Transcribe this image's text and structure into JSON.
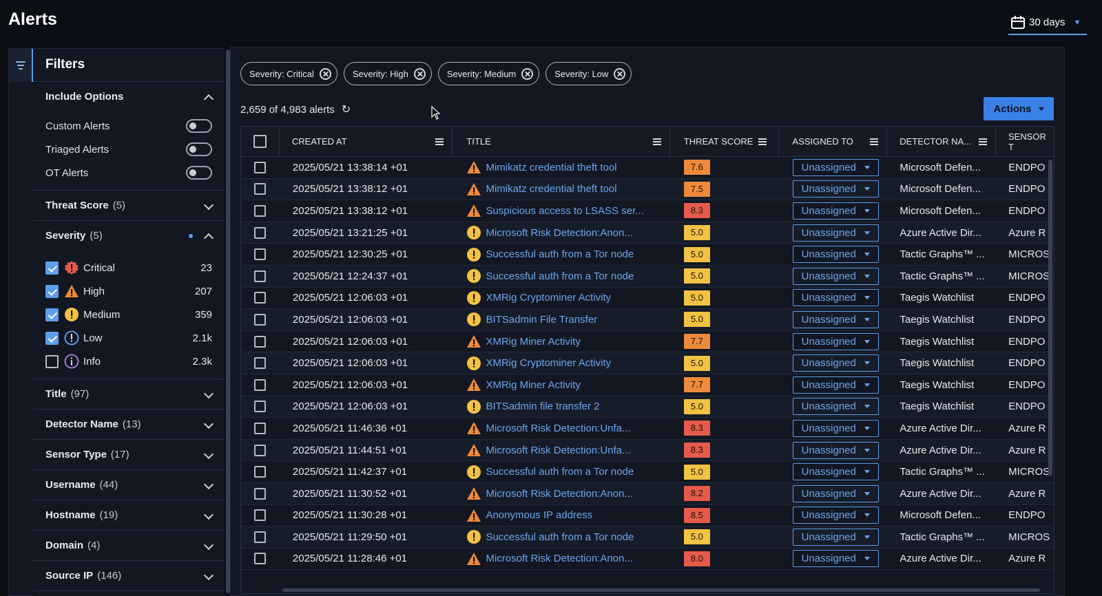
{
  "header": {
    "title": "Alerts",
    "date_range": "30 days"
  },
  "filters": {
    "title": "Filters",
    "include_options": {
      "label": "Include Options",
      "options": [
        {
          "label": "Custom Alerts",
          "on": false
        },
        {
          "label": "Triaged Alerts",
          "on": false
        },
        {
          "label": "OT Alerts",
          "on": false
        }
      ]
    },
    "threat_score": {
      "label": "Threat Score",
      "count": "(5)"
    },
    "severity": {
      "label": "Severity",
      "count": "(5)",
      "items": [
        {
          "label": "Critical",
          "count": "23",
          "checked": true,
          "icon": "critical-icon"
        },
        {
          "label": "High",
          "count": "207",
          "checked": true,
          "icon": "high-icon"
        },
        {
          "label": "Medium",
          "count": "359",
          "checked": true,
          "icon": "medium-icon"
        },
        {
          "label": "Low",
          "count": "2.1k",
          "checked": true,
          "icon": "low-icon"
        },
        {
          "label": "Info",
          "count": "2.3k",
          "checked": false,
          "icon": "info-icon"
        }
      ]
    },
    "sections": [
      {
        "label": "Title",
        "count": "(97)"
      },
      {
        "label": "Detector Name",
        "count": "(13)"
      },
      {
        "label": "Sensor Type",
        "count": "(17)"
      },
      {
        "label": "Username",
        "count": "(44)"
      },
      {
        "label": "Hostname",
        "count": "(19)"
      },
      {
        "label": "Domain",
        "count": "(4)"
      },
      {
        "label": "Source IP",
        "count": "(146)"
      }
    ]
  },
  "chips": [
    "Severity: Critical",
    "Severity: High",
    "Severity: Medium",
    "Severity: Low"
  ],
  "summary": "2,659 of 4,983 alerts",
  "actions_label": "Actions",
  "table": {
    "columns": [
      "CREATED AT",
      "TITLE",
      "THREAT SCORE",
      "ASSIGNED TO",
      "DETECTOR NA...",
      "SENSOR T"
    ],
    "rows": [
      {
        "created": "2025/05/21 13:38:14 +01",
        "sev": "high",
        "title": "Mimikatz credential theft tool",
        "score": "7.6",
        "assigned": "Unassigned",
        "detector": "Microsoft Defen...",
        "sensor": "ENDPO"
      },
      {
        "created": "2025/05/21 13:38:12 +01",
        "sev": "high",
        "title": "Mimikatz credential theft tool",
        "score": "7.5",
        "assigned": "Unassigned",
        "detector": "Microsoft Defen...",
        "sensor": "ENDPO"
      },
      {
        "created": "2025/05/21 13:38:12 +01",
        "sev": "high",
        "title": "Suspicious access to LSASS ser...",
        "score": "8.3",
        "assigned": "Unassigned",
        "detector": "Microsoft Defen...",
        "sensor": "ENDPO"
      },
      {
        "created": "2025/05/21 13:21:25 +01",
        "sev": "medium",
        "title": "Microsoft Risk Detection:Anon...",
        "score": "5.0",
        "assigned": "Unassigned",
        "detector": "Azure Active Dir...",
        "sensor": "Azure R"
      },
      {
        "created": "2025/05/21 12:30:25 +01",
        "sev": "medium",
        "title": "Successful auth from a Tor node",
        "score": "5.0",
        "assigned": "Unassigned",
        "detector": "Tactic Graphs™ ...",
        "sensor": "MICROS"
      },
      {
        "created": "2025/05/21 12:24:37 +01",
        "sev": "medium",
        "title": "Successful auth from a Tor node",
        "score": "5.0",
        "assigned": "Unassigned",
        "detector": "Tactic Graphs™ ...",
        "sensor": "MICROS"
      },
      {
        "created": "2025/05/21 12:06:03 +01",
        "sev": "medium",
        "title": "XMRig Cryptominer Activity",
        "score": "5.0",
        "assigned": "Unassigned",
        "detector": "Taegis Watchlist",
        "sensor": "ENDPO"
      },
      {
        "created": "2025/05/21 12:06:03 +01",
        "sev": "medium",
        "title": "BITSadmin File Transfer",
        "score": "5.0",
        "assigned": "Unassigned",
        "detector": "Taegis Watchlist",
        "sensor": "ENDPO"
      },
      {
        "created": "2025/05/21 12:06:03 +01",
        "sev": "high",
        "title": "XMRig Miner Activity",
        "score": "7.7",
        "assigned": "Unassigned",
        "detector": "Taegis Watchlist",
        "sensor": "ENDPO"
      },
      {
        "created": "2025/05/21 12:06:03 +01",
        "sev": "medium",
        "title": "XMRig Cryptominer Activity",
        "score": "5.0",
        "assigned": "Unassigned",
        "detector": "Taegis Watchlist",
        "sensor": "ENDPO"
      },
      {
        "created": "2025/05/21 12:06:03 +01",
        "sev": "high",
        "title": "XMRig Miner Activity",
        "score": "7.7",
        "assigned": "Unassigned",
        "detector": "Taegis Watchlist",
        "sensor": "ENDPO"
      },
      {
        "created": "2025/05/21 12:06:03 +01",
        "sev": "medium",
        "title": "BITSadmin file transfer 2",
        "score": "5.0",
        "assigned": "Unassigned",
        "detector": "Taegis Watchlist",
        "sensor": "ENDPO"
      },
      {
        "created": "2025/05/21 11:46:36 +01",
        "sev": "high",
        "title": "Microsoft Risk Detection:Unfa...",
        "score": "8.3",
        "assigned": "Unassigned",
        "detector": "Azure Active Dir...",
        "sensor": "Azure R"
      },
      {
        "created": "2025/05/21 11:44:51 +01",
        "sev": "high",
        "title": "Microsoft Risk Detection:Unfa...",
        "score": "8.3",
        "assigned": "Unassigned",
        "detector": "Azure Active Dir...",
        "sensor": "Azure R"
      },
      {
        "created": "2025/05/21 11:42:37 +01",
        "sev": "medium",
        "title": "Successful auth from a Tor node",
        "score": "5.0",
        "assigned": "Unassigned",
        "detector": "Tactic Graphs™ ...",
        "sensor": "MICROS"
      },
      {
        "created": "2025/05/21 11:30:52 +01",
        "sev": "high",
        "title": "Microsoft Risk Detection:Anon...",
        "score": "8.2",
        "assigned": "Unassigned",
        "detector": "Azure Active Dir...",
        "sensor": "Azure R"
      },
      {
        "created": "2025/05/21 11:30:28 +01",
        "sev": "high",
        "title": "Anonymous IP address",
        "score": "8.5",
        "assigned": "Unassigned",
        "detector": "Microsoft Defen...",
        "sensor": "ENDPO"
      },
      {
        "created": "2025/05/21 11:29:50 +01",
        "sev": "medium",
        "title": "Successful auth from a Tor node",
        "score": "5.0",
        "assigned": "Unassigned",
        "detector": "Tactic Graphs™ ...",
        "sensor": "MICROS"
      },
      {
        "created": "2025/05/21 11:28:46 +01",
        "sev": "high",
        "title": "Microsoft Risk Detection:Anon...",
        "score": "8.0",
        "assigned": "Unassigned",
        "detector": "Azure Active Dir...",
        "sensor": "Azure R"
      }
    ]
  },
  "colors": {
    "accent": "#5e9ee8",
    "link": "#6aa6f0",
    "score_high": "#ee8a3c",
    "score_critical": "#e65a4c",
    "score_medium": "#f2c244",
    "background": "#0b0e15",
    "panel": "#121722"
  }
}
